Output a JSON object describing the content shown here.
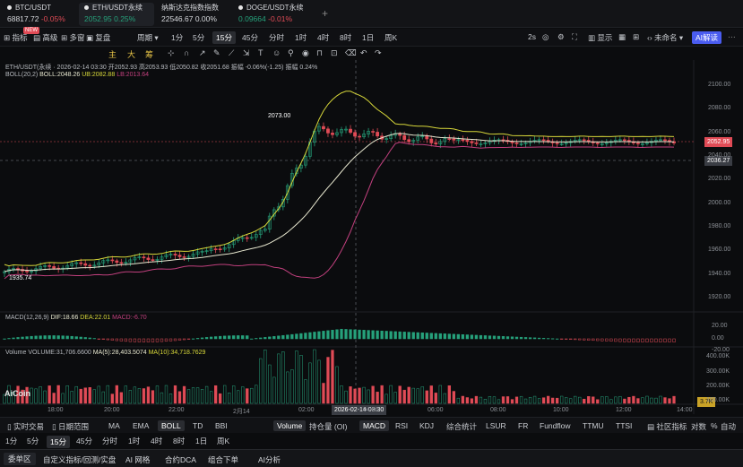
{
  "tickers": [
    {
      "name": "BTC/USDT",
      "price": "68817.72",
      "change": "-0.05%",
      "active": false
    },
    {
      "name": "ETH/USDT永续",
      "price": "2052.95",
      "change": "0.25%",
      "active": true
    },
    {
      "name": "纳斯达克指数指数",
      "price": "22546.67",
      "change": "0.00%",
      "active": false
    },
    {
      "name": "DOGE/USDT永续",
      "price": "0.09664",
      "change": "-0.01%",
      "active": false
    },
    {
      "name": "+",
      "price": "",
      "change": ""
    }
  ],
  "toolbar": {
    "indicators": "指标",
    "advanced": "高级",
    "multi": "多窗",
    "replay": "复盘",
    "period": "周期",
    "new_badge": "NEW",
    "timeframes": [
      "1分",
      "5分",
      "15分",
      "45分",
      "分时",
      "1时",
      "4时",
      "8时",
      "1日",
      "周K"
    ],
    "selected_tf": "15分",
    "right_2s": "2s",
    "display": "显示",
    "unnamed": "未命名",
    "ai_button": "AI解读"
  },
  "drawing_tools": [
    "主",
    "大",
    "筹"
  ],
  "chart": {
    "header": "ETH/USDT(永续 · 2026-02-14 03:30  开2052.93  高2053.93  低2050.82  收2051.68  振幅 -0.06%(-1.25)  振幅 0.24%",
    "boll_label": "BOLL(20,2)",
    "boll_mid": "BOLL:2048.26",
    "boll_ub": "UB:2082.88",
    "boll_lb": "LB:2013.64",
    "price_axis": [
      "2100.00",
      "2080.00",
      "2060.00",
      "2040.00",
      "2020.00",
      "2000.00",
      "1980.00",
      "1960.00",
      "1940.00",
      "1920.00"
    ],
    "current_price": "2052.95",
    "cursor_price": "2036.27",
    "high_marker": "2073.00",
    "low_marker": "1935.74",
    "macd_label": "MACD(12,26,9)",
    "macd_dif": "DIF:18.66",
    "macd_dea": "DEA:22.01",
    "macd_val": "MACD:-6.70",
    "macd_axis": [
      "20.00",
      "0.00",
      "-20.00"
    ],
    "vol_label": "Volume",
    "vol_value": "VOLUME:31,706.6600",
    "vol_ma5": "MA(5):28,403.5074",
    "vol_ma10": "MA(10):34,718.7629",
    "vol_axis": [
      "400.00K",
      "300.00K",
      "200.00K",
      "100.00K"
    ],
    "vol_current": "3.7K",
    "time_axis": [
      "18:00",
      "20:00",
      "22:00",
      "2月14",
      "02:00",
      "04:00",
      "06:00",
      "08:00",
      "10:00",
      "12:00",
      "14:00"
    ],
    "cursor_time": "2026-02-14 03:30",
    "logo": "AiCoin",
    "colors": {
      "up": "#26a17b",
      "down": "#e04b56",
      "mid": "#e8e8d0",
      "ub": "#d8d83a",
      "lb": "#c2407e"
    }
  },
  "indicator_bar": {
    "trade_tag": "实时交易",
    "date_range": "日期范围",
    "main_items": [
      "MA",
      "EMA",
      "BOLL",
      "TD",
      "BBI"
    ],
    "selected_main": "BOLL",
    "sub_items": [
      "Volume",
      "持仓量 (OI)",
      "MACD",
      "RSI",
      "KDJ",
      "综合统计",
      "LSUR",
      "FR",
      "Fundflow",
      "TTMU",
      "TTSI"
    ],
    "selected_sub": [
      "Volume",
      "MACD"
    ],
    "community": "社区指标",
    "right": [
      "对数",
      "%",
      "自动"
    ]
  },
  "timeframe_bar": [
    "1分",
    "5分",
    "15分",
    "45分",
    "分时",
    "1时",
    "4时",
    "8时",
    "1日",
    "周K"
  ],
  "timeframe_selected": "15分",
  "bottom_tabs": [
    "委单区",
    "自定义指标/回测/实盘",
    "AI 网格",
    "合约DCA",
    "组合下单",
    "AI分析"
  ],
  "bottom_selected": "委单区"
}
